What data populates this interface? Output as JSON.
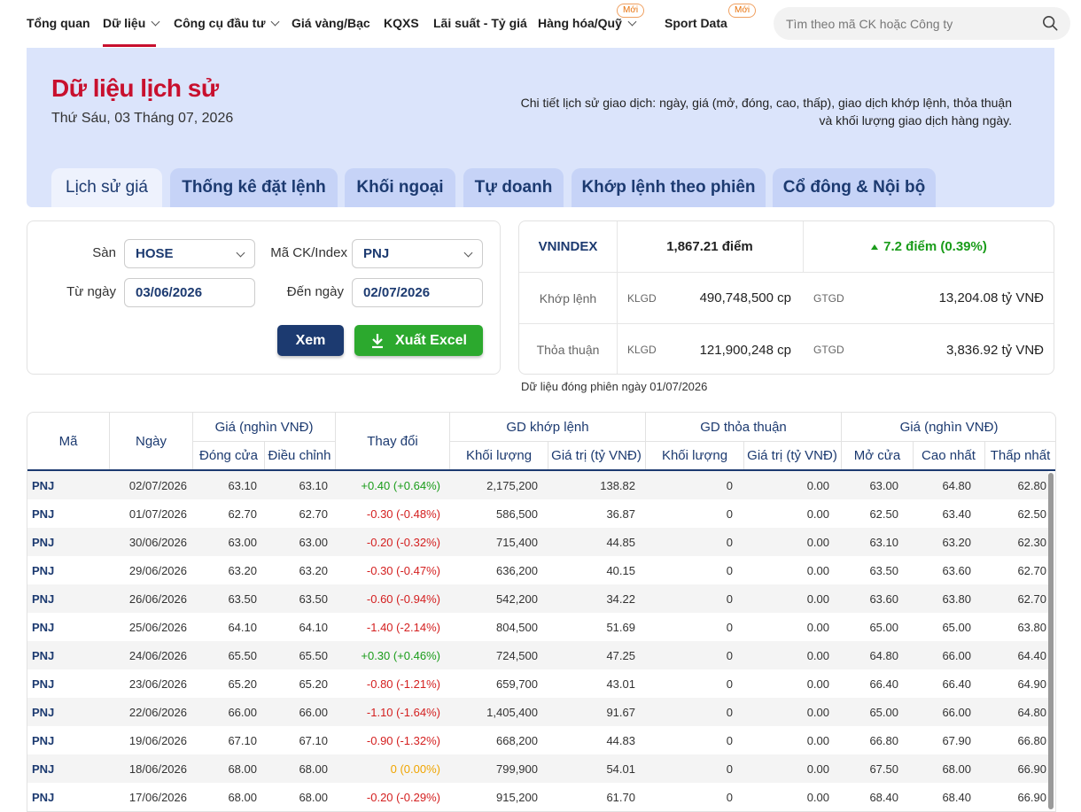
{
  "nav": {
    "items": [
      "Tổng quan",
      "Dữ liệu",
      "Công cụ đầu tư",
      "Giá vàng/Bạc",
      "KQXS",
      "Lãi suất - Tỷ giá",
      "Hàng hóa/Quỹ",
      "Sport Data"
    ],
    "badge_new": "Mới",
    "search_placeholder": "Tìm theo mã CK hoặc Công ty"
  },
  "hero": {
    "title": "Dữ liệu lịch sử",
    "date": "Thứ Sáu, 03 Tháng 07, 2026",
    "desc_line1": "Chi tiết lịch sử giao dịch: ngày, giá (mở, đóng, cao, thấp), giao dịch khớp lệnh, thỏa thuận",
    "desc_line2": "và khối lượng giao dịch hàng ngày.",
    "tabs": [
      "Lịch sử giá",
      "Thống kê đặt lệnh",
      "Khối ngoại",
      "Tự doanh",
      "Khớp lệnh theo phiên",
      "Cổ đông & Nội bộ"
    ]
  },
  "filter": {
    "san_label": "Sàn",
    "san_value": "HOSE",
    "mack_label": "Mã CK/Index",
    "mack_value": "PNJ",
    "tungay_label": "Từ ngày",
    "tungay_value": "03/06/2026",
    "denngay_label": "Đến ngày",
    "denngay_value": "02/07/2026",
    "xem_label": "Xem",
    "excel_label": "Xuất Excel"
  },
  "index": {
    "name": "VNINDEX",
    "points": "1,867.21 điểm",
    "change": "7.2 điểm (0.39%)",
    "khoplenh_label": "Khớp lệnh",
    "thoathuan_label": "Thỏa thuận",
    "klgd_label": "KLGD",
    "gtgd_label": "GTGD",
    "khoplenh_klgd": "490,748,500 cp",
    "khoplenh_gtgd": "13,204.08 tỷ VNĐ",
    "thoathuan_klgd": "121,900,248 cp",
    "thoathuan_gtgd": "3,836.92 tỷ VNĐ",
    "note": "Dữ liệu đóng phiên ngày 01/07/2026",
    "up_color": "#1a9c1a"
  },
  "table": {
    "headers": {
      "ma": "Mã",
      "ngay": "Ngày",
      "gia_group": "Giá (nghìn VNĐ)",
      "dong_cua": "Đóng cửa",
      "dieu_chinh": "Điều chỉnh",
      "thay_doi": "Thay đổi",
      "khop_group": "GD khớp lệnh",
      "khop_kl": "Khối lượng",
      "khop_gt": "Giá trị (tỷ VNĐ)",
      "tt_group": "GD thỏa thuận",
      "tt_kl": "Khối lượng",
      "tt_gt": "Giá trị (tỷ VNĐ)",
      "gia2_group": "Giá (nghìn VNĐ)",
      "mo_cua": "Mở cửa",
      "cao_nhat": "Cao nhất",
      "thap_nhat": "Thấp nhất"
    },
    "rows": [
      [
        "PNJ",
        "02/07/2026",
        "63.10",
        "63.10",
        "+0.40 (+0.64%)",
        "2,175,200",
        "138.82",
        "0",
        "0.00",
        "63.00",
        "64.80",
        "62.80",
        "up"
      ],
      [
        "PNJ",
        "01/07/2026",
        "62.70",
        "62.70",
        "-0.30 (-0.48%)",
        "586,500",
        "36.87",
        "0",
        "0.00",
        "62.50",
        "63.40",
        "62.50",
        "down"
      ],
      [
        "PNJ",
        "30/06/2026",
        "63.00",
        "63.00",
        "-0.20 (-0.32%)",
        "715,400",
        "44.85",
        "0",
        "0.00",
        "63.10",
        "63.20",
        "62.30",
        "down"
      ],
      [
        "PNJ",
        "29/06/2026",
        "63.20",
        "63.20",
        "-0.30 (-0.47%)",
        "636,200",
        "40.15",
        "0",
        "0.00",
        "63.50",
        "63.60",
        "62.70",
        "down"
      ],
      [
        "PNJ",
        "26/06/2026",
        "63.50",
        "63.50",
        "-0.60 (-0.94%)",
        "542,200",
        "34.22",
        "0",
        "0.00",
        "63.60",
        "63.80",
        "62.70",
        "down"
      ],
      [
        "PNJ",
        "25/06/2026",
        "64.10",
        "64.10",
        "-1.40 (-2.14%)",
        "804,500",
        "51.69",
        "0",
        "0.00",
        "65.00",
        "65.00",
        "63.80",
        "down"
      ],
      [
        "PNJ",
        "24/06/2026",
        "65.50",
        "65.50",
        "+0.30 (+0.46%)",
        "724,500",
        "47.25",
        "0",
        "0.00",
        "64.80",
        "66.00",
        "64.40",
        "up"
      ],
      [
        "PNJ",
        "23/06/2026",
        "65.20",
        "65.20",
        "-0.80 (-1.21%)",
        "659,700",
        "43.01",
        "0",
        "0.00",
        "66.40",
        "66.40",
        "64.90",
        "down"
      ],
      [
        "PNJ",
        "22/06/2026",
        "66.00",
        "66.00",
        "-1.10 (-1.64%)",
        "1,405,400",
        "91.67",
        "0",
        "0.00",
        "65.00",
        "66.00",
        "64.80",
        "down"
      ],
      [
        "PNJ",
        "19/06/2026",
        "67.10",
        "67.10",
        "-0.90 (-1.32%)",
        "668,200",
        "44.83",
        "0",
        "0.00",
        "66.80",
        "67.90",
        "66.80",
        "down"
      ],
      [
        "PNJ",
        "18/06/2026",
        "68.00",
        "68.00",
        "0 (0.00%)",
        "799,900",
        "54.01",
        "0",
        "0.00",
        "67.50",
        "68.00",
        "66.90",
        "flat"
      ],
      [
        "PNJ",
        "17/06/2026",
        "68.00",
        "68.00",
        "-0.20 (-0.29%)",
        "915,200",
        "61.70",
        "0",
        "0.00",
        "68.40",
        "68.40",
        "66.90",
        "down"
      ]
    ]
  },
  "colors": {
    "brand_red": "#c8102e",
    "navy": "#1c3a70",
    "green": "#1a9c1a",
    "red": "#d42020",
    "amber": "#f0a500"
  }
}
